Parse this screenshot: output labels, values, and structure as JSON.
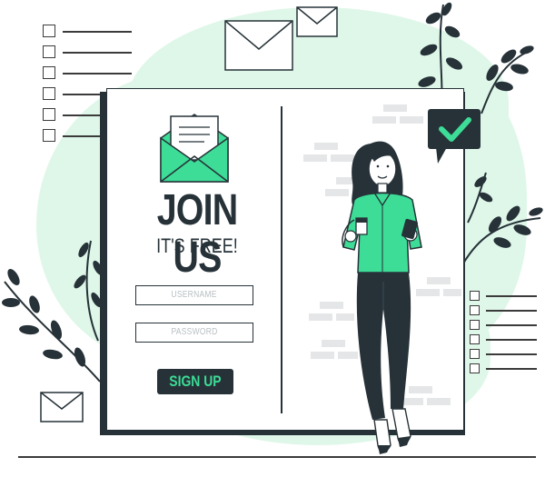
{
  "signup": {
    "title": "JOIN US",
    "subtitle": "IT'S FREE!",
    "username_placeholder": "USERNAME",
    "password_placeholder": "PASSWORD",
    "submit_label": "SIGN UP"
  },
  "icons": [
    "envelope-icon",
    "checkmark-bubble-icon",
    "checklist-icon",
    "leaf-icon"
  ],
  "colors": {
    "accent": "#3ddc97",
    "dark": "#263238",
    "background_blob": "#dff7e9",
    "placeholder": "#b8bfc2"
  }
}
